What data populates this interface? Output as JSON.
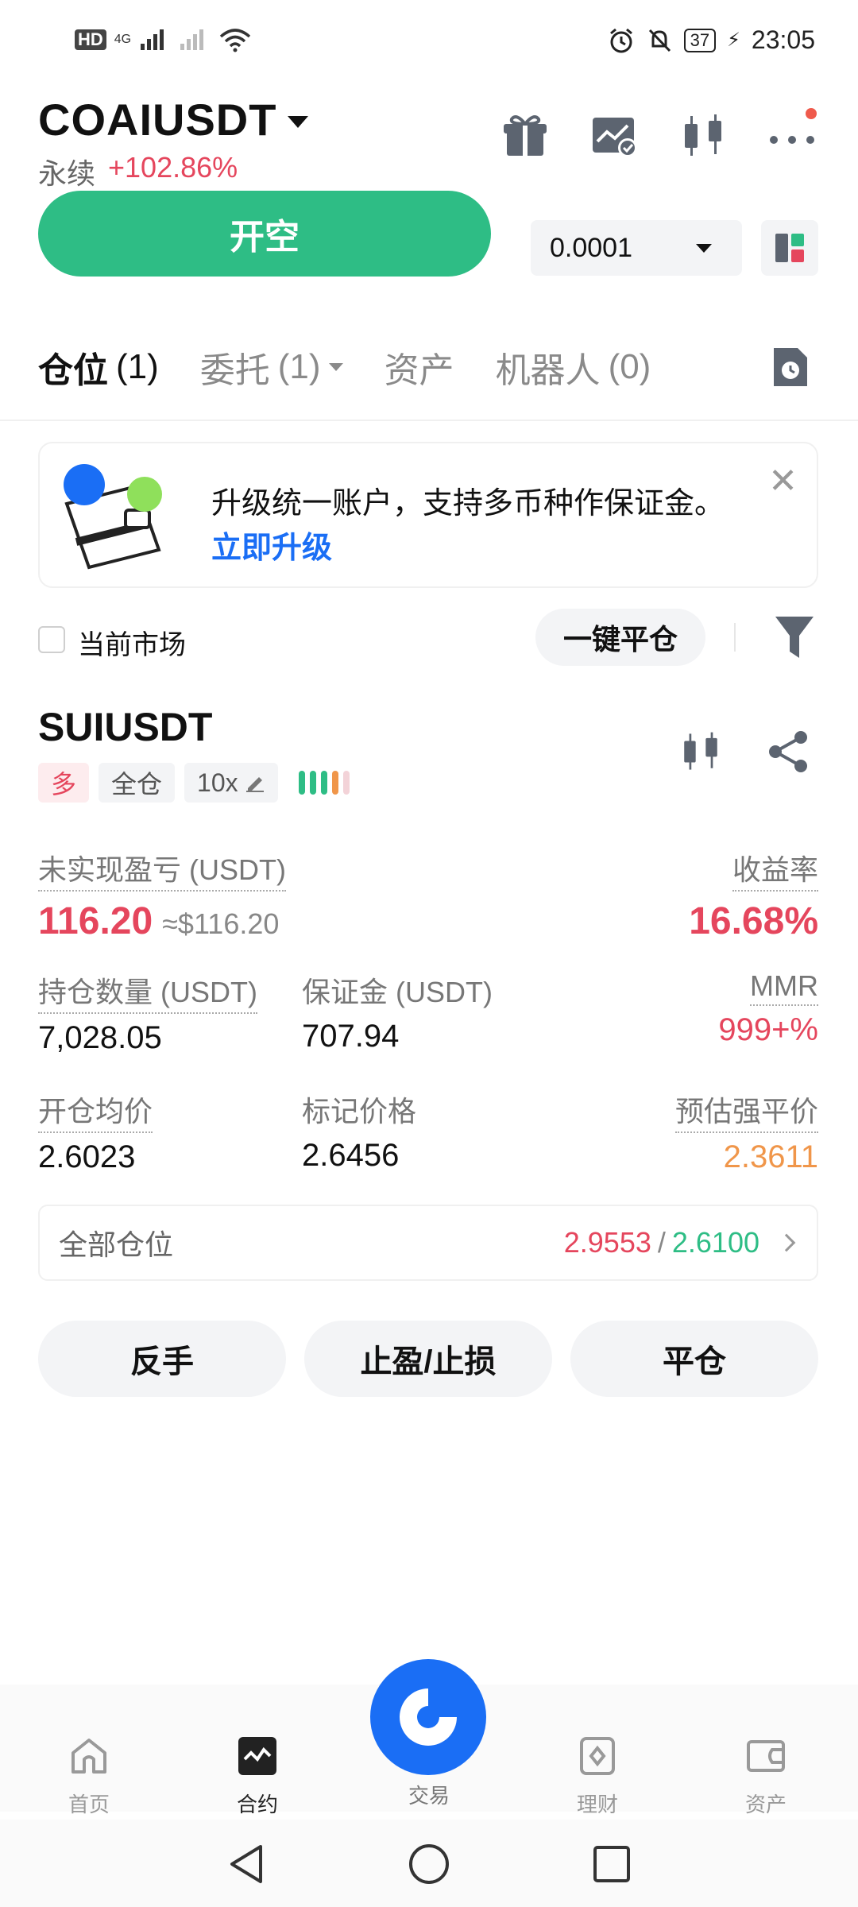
{
  "status_bar": {
    "left_label": "HD",
    "network": "4G",
    "battery": "37",
    "time": "23:05"
  },
  "header": {
    "pair": "COAIUSDT",
    "contract_type": "永续",
    "change": "+102.86%"
  },
  "order": {
    "open_short_label": "开空",
    "quantity": "0.0001"
  },
  "tabs": [
    {
      "label": "仓位",
      "count": "(1)"
    },
    {
      "label": "委托",
      "count": "(1)"
    },
    {
      "label": "资产",
      "count": ""
    },
    {
      "label": "机器人",
      "count": "(0)"
    }
  ],
  "banner": {
    "text": "升级统一账户，支持多币种作保证金。",
    "link": "立即升级",
    "close": "✕"
  },
  "filter": {
    "current_market_label": "当前市场",
    "close_all_label": "一键平仓"
  },
  "position": {
    "symbol": "SUIUSDT",
    "side": "多",
    "margin_mode": "全仓",
    "leverage": "10x",
    "unrealized_pnl_label": "未实现盈亏 (USDT)",
    "unrealized_pnl": "116.20",
    "unrealized_pnl_usd": "≈$116.20",
    "roe_label": "收益率",
    "roe": "16.68%",
    "size_label": "持仓数量 (USDT)",
    "size": "7,028.05",
    "margin_label": "保证金 (USDT)",
    "margin": "707.94",
    "mmr_label": "MMR",
    "mmr": "999+%",
    "entry_label": "开仓均价",
    "entry": "2.6023",
    "mark_label": "标记价格",
    "mark": "2.6456",
    "liq_label": "预估强平价",
    "liq": "2.3611"
  },
  "all_positions": {
    "label": "全部仓位",
    "value_red": "2.9553",
    "separator": "/",
    "value_green": "2.6100"
  },
  "actions": {
    "reverse": "反手",
    "tpsl": "止盈/止损",
    "close": "平仓"
  },
  "bottom_nav": [
    {
      "label": "首页",
      "icon": "home-icon"
    },
    {
      "label": "合约",
      "icon": "futures-icon"
    },
    {
      "label": "交易",
      "icon": "trade-icon"
    },
    {
      "label": "理财",
      "icon": "earn-icon"
    },
    {
      "label": "资产",
      "icon": "wallet-icon"
    }
  ],
  "colors": {
    "green": "#2ebd85",
    "red": "#e5465d",
    "orange": "#f0964a",
    "blue": "#1a6ef5"
  }
}
